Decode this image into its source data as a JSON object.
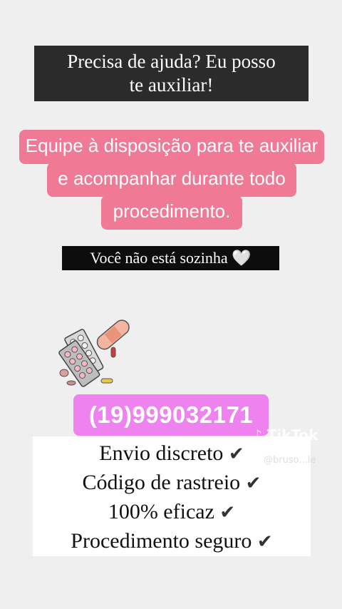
{
  "header": {
    "line1": "Precisa de ajuda? Eu posso",
    "line2": "te auxiliar!"
  },
  "pink_text": {
    "line1": "Equipe à disposição para te auxiliar",
    "line2": "e acompanhar durante todo",
    "line3": "procedimento."
  },
  "support": {
    "text": "Você não está sozinha",
    "heart": "🤍"
  },
  "illustration": {
    "icon": "pills-and-bandage-icon"
  },
  "contact": {
    "phone": "(19)999032171"
  },
  "features": [
    {
      "label": "Envio discreto",
      "check": "✔"
    },
    {
      "label": "Código de rastreio",
      "check": "✔"
    },
    {
      "label": "100% eficaz",
      "check": "✔"
    },
    {
      "label": "Procedimento seguro",
      "check": "✔"
    }
  ],
  "watermark": {
    "brand": "TikTok",
    "handle": "@bruso...le"
  },
  "colors": {
    "pink": "#f07a96",
    "phone_bg": "#ee82ee",
    "dark_box": "#2b2b2b"
  }
}
